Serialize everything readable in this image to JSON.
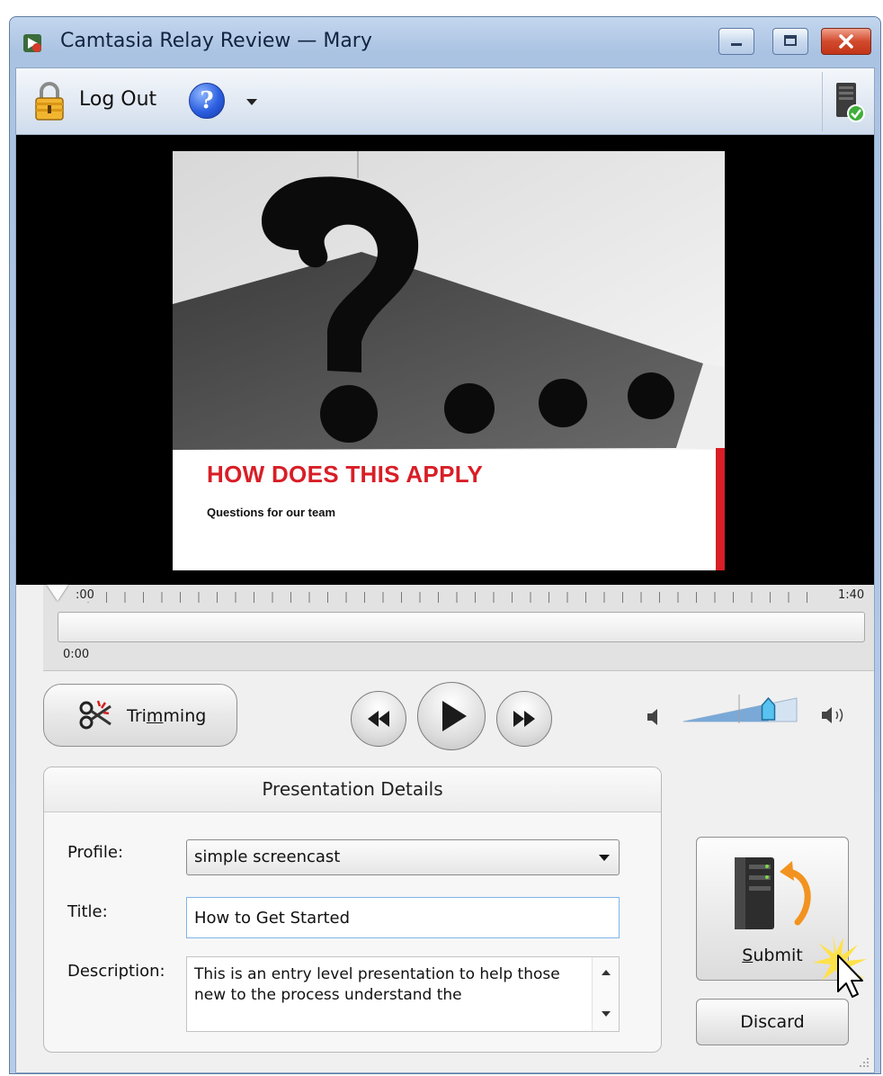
{
  "window": {
    "title": "Camtasia Relay Review — Mary"
  },
  "toolbar": {
    "logout_label": "Log Out",
    "help_glyph": "?",
    "icons": [
      "lock-icon",
      "help-icon",
      "chevron-down-icon",
      "server-status-icon"
    ]
  },
  "video": {
    "slide_title": "HOW DOES THIS APPLY",
    "slide_subtitle": "Questions for our team"
  },
  "timeline": {
    "start_label": ":00",
    "end_label": "1:40",
    "current_time": "0:00",
    "position": 0.0
  },
  "controls": {
    "trim_label_pre": "Tri",
    "trim_label_mnemonic": "m",
    "trim_label_post": "ming",
    "volume_level": 0.75
  },
  "details": {
    "header": "Presentation Details",
    "profile_label": "Profile:",
    "profile_value": "simple screencast",
    "title_label": "Title:",
    "title_value": "How to Get Started",
    "description_label": "Description:",
    "description_value": "This is an entry level presentation to help those new to the process understand the"
  },
  "actions": {
    "submit_mnemonic": "S",
    "submit_rest": "ubmit",
    "discard_label": "Discard"
  },
  "colors": {
    "slide_accent": "#d81e26",
    "titlebar": "#b7cce8",
    "input_focus": "#7eb4ea"
  }
}
